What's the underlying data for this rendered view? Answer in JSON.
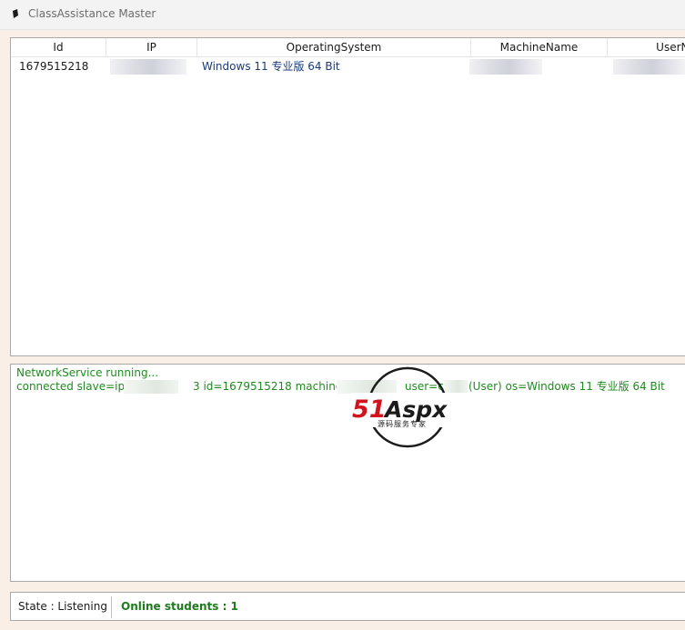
{
  "window": {
    "title": "ClassAssistance Master"
  },
  "grid": {
    "columns": [
      "Id",
      "IP",
      "OperatingSystem",
      "MachineName",
      "UserNa"
    ],
    "rows": [
      {
        "id": "1679515218",
        "ip": "",
        "os": "Windows 11 专业版 64 Bit",
        "machine": "",
        "user": ""
      }
    ]
  },
  "log": {
    "line1": "NetworkService running...",
    "line2_prefix": "connected slave=ip=",
    "line2_mid": "3 id=1679515218 machine=",
    "line2_user": "user=c",
    "line2_tail": "(User) os=Windows 11 专业版 64 Bit"
  },
  "watermark": {
    "brand_51": "51",
    "brand_aspx": "Aspx",
    "sub": "源码服务专家"
  },
  "status": {
    "state": "State : Listening",
    "online": "Online students : 1"
  },
  "colors": {
    "log_text": "#1f8a1f",
    "online_text": "#1f7a1f",
    "os_text": "#1a3a7a",
    "watermark_red": "#d0141d",
    "watermark_green": "#1e9e3a"
  }
}
